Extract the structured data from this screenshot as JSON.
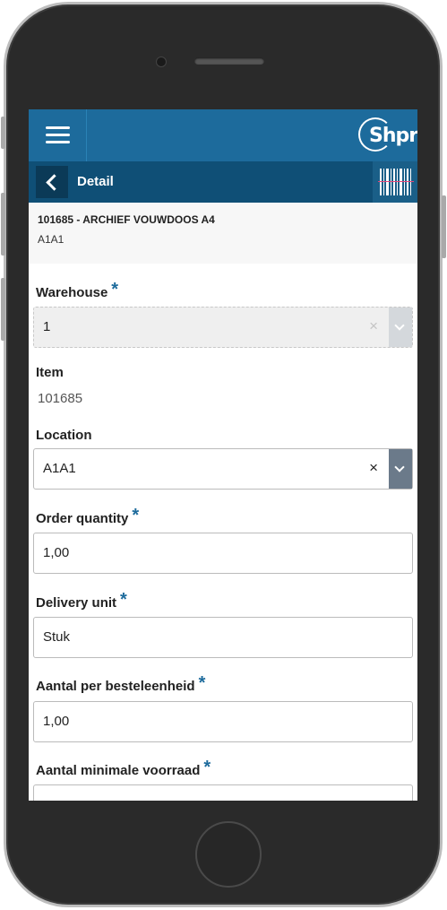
{
  "header": {
    "logo_text": "Shpr",
    "title": "Detail"
  },
  "item": {
    "title": "101685 - ARCHIEF VOUWDOOS A4",
    "location": "A1A1"
  },
  "form": {
    "warehouse": {
      "label": "Warehouse",
      "required": "*",
      "value": "1",
      "clear": "×"
    },
    "item": {
      "label": "Item",
      "value": "101685"
    },
    "location": {
      "label": "Location",
      "value": "A1A1",
      "clear": "×"
    },
    "order_quantity": {
      "label": "Order quantity",
      "required": "*",
      "value": "1,00"
    },
    "delivery_unit": {
      "label": "Delivery unit",
      "required": "*",
      "value": "Stuk"
    },
    "aantal_per_besteleenheid": {
      "label": "Aantal per besteleenheid",
      "required": "*",
      "value": "1,00"
    },
    "aantal_minimale_voorraad": {
      "label": "Aantal minimale voorraad",
      "required": "*"
    }
  },
  "colors": {
    "topbar": "#1d6b9c",
    "subbar": "#0f4f76",
    "required": "#1d6b9c"
  },
  "icons": {
    "menu": "hamburger-icon",
    "back": "chevron-left-icon",
    "barcode": "barcode-scan-icon"
  }
}
